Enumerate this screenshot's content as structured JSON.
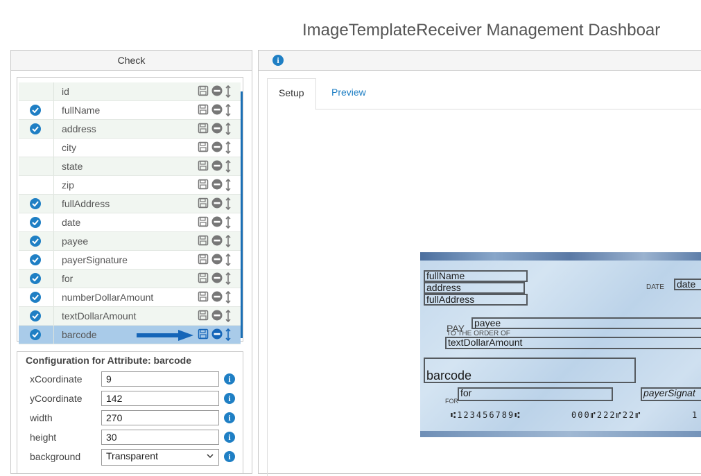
{
  "page_title": "ImageTemplateReceiver Management Dashboar",
  "left_panel": {
    "header": "Check",
    "attributes": [
      {
        "label": "id",
        "checked": false,
        "selected": false
      },
      {
        "label": "fullName",
        "checked": true,
        "selected": false
      },
      {
        "label": "address",
        "checked": true,
        "selected": false
      },
      {
        "label": "city",
        "checked": false,
        "selected": false
      },
      {
        "label": "state",
        "checked": false,
        "selected": false
      },
      {
        "label": "zip",
        "checked": false,
        "selected": false
      },
      {
        "label": "fullAddress",
        "checked": true,
        "selected": false
      },
      {
        "label": "date",
        "checked": true,
        "selected": false
      },
      {
        "label": "payee",
        "checked": true,
        "selected": false
      },
      {
        "label": "payerSignature",
        "checked": true,
        "selected": false
      },
      {
        "label": "for",
        "checked": true,
        "selected": false
      },
      {
        "label": "numberDollarAmount",
        "checked": true,
        "selected": false
      },
      {
        "label": "textDollarAmount",
        "checked": true,
        "selected": false
      },
      {
        "label": "barcode",
        "checked": true,
        "selected": true
      }
    ]
  },
  "config": {
    "title": "Configuration for Attribute: barcode",
    "fields": {
      "xCoordinate": {
        "label": "xCoordinate",
        "value": "9"
      },
      "yCoordinate": {
        "label": "yCoordinate",
        "value": "142"
      },
      "width": {
        "label": "width",
        "value": "270"
      },
      "height": {
        "label": "height",
        "value": "30"
      },
      "background": {
        "label": "background",
        "value": "Transparent"
      }
    }
  },
  "right_panel": {
    "tabs": {
      "setup": "Setup",
      "preview": "Preview"
    }
  },
  "check_preview": {
    "fields": {
      "fullName": "fullName",
      "address": "address",
      "fullAddress": "fullAddress",
      "date_label": "DATE",
      "date": "date",
      "pay_label": "PAY",
      "payee": "payee",
      "order_label": "TO THE ORDER OF",
      "textDollarAmount": "textDollarAmount",
      "barcode": "barcode",
      "for_label": "FOR",
      "for": "for",
      "payerSignature": "payerSignat",
      "micr_routing": "⑆123456789⑆",
      "micr_account": "000⑈222⑈22⑈",
      "micr_check": "1"
    }
  },
  "colors": {
    "accent": "#1f7fc4",
    "selected_row": "#a9cbe9",
    "alt_row": "#f1f6f1"
  },
  "icons": [
    "check-circle-icon",
    "save-icon",
    "minus-circle-icon",
    "move-vertical-icon",
    "info-icon",
    "chevron-down-icon",
    "arrow-right-icon"
  ]
}
